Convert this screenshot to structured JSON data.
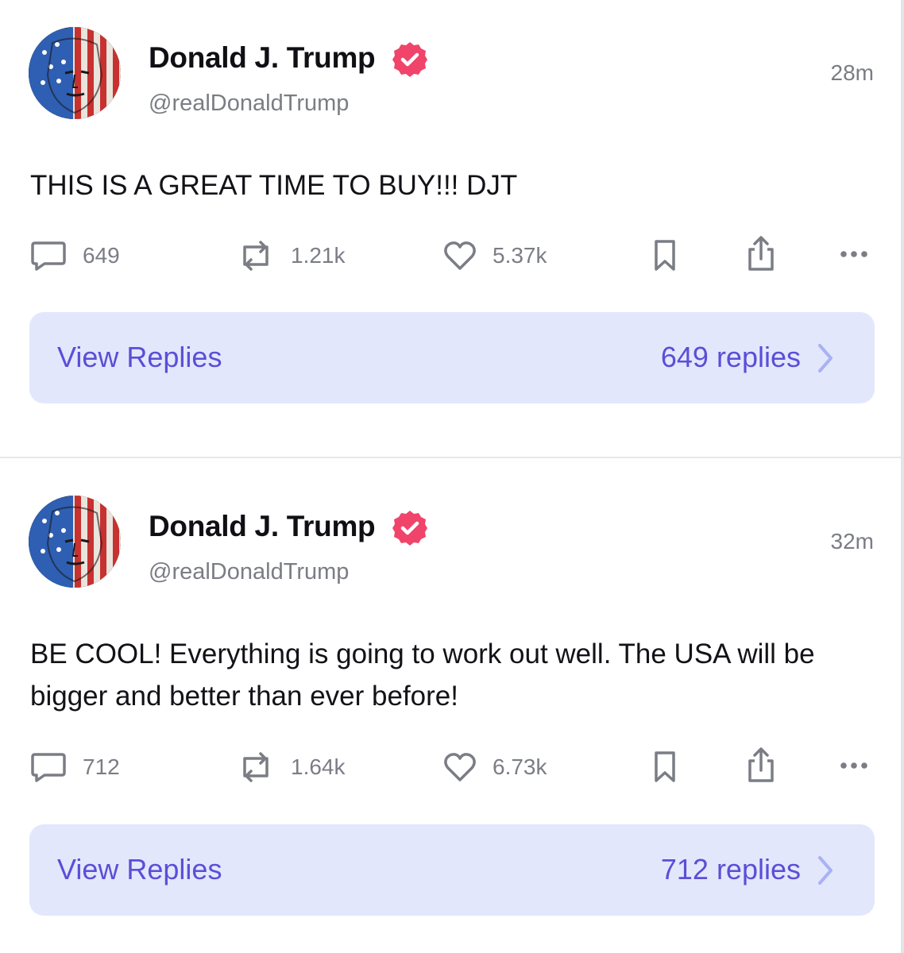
{
  "posts": [
    {
      "author": {
        "display_name": "Donald J. Trump",
        "handle": "@realDonaldTrump",
        "verified": true,
        "avatar_icon": "flag-face-avatar"
      },
      "timestamp": "28m",
      "text": "THIS IS A GREAT TIME TO BUY!!! DJT",
      "actions": {
        "replies": "649",
        "reposts": "1.21k",
        "likes": "5.37k"
      },
      "view_replies": {
        "label": "View Replies",
        "count": "649 replies"
      }
    },
    {
      "author": {
        "display_name": "Donald J. Trump",
        "handle": "@realDonaldTrump",
        "verified": true,
        "avatar_icon": "flag-face-avatar"
      },
      "timestamp": "32m",
      "text": "BE COOL! Everything is going to work out well. The USA will be bigger and better than ever before!",
      "actions": {
        "replies": "712",
        "reposts": "1.64k",
        "likes": "6.73k"
      },
      "view_replies": {
        "label": "View Replies",
        "count": "712 replies"
      }
    }
  ],
  "icons": {
    "reply": "comment-bubble-icon",
    "repost": "repost-icon",
    "like": "heart-icon",
    "bookmark": "bookmark-icon",
    "share": "share-icon",
    "more": "more-dots-icon",
    "verified": "verified-badge-icon",
    "chevron": "chevron-right-icon"
  },
  "colors": {
    "verified_badge": "#f0446b",
    "accent": "#5a4fd6",
    "view_replies_bg": "#e3e7fc",
    "muted_text": "#7b7d85"
  }
}
